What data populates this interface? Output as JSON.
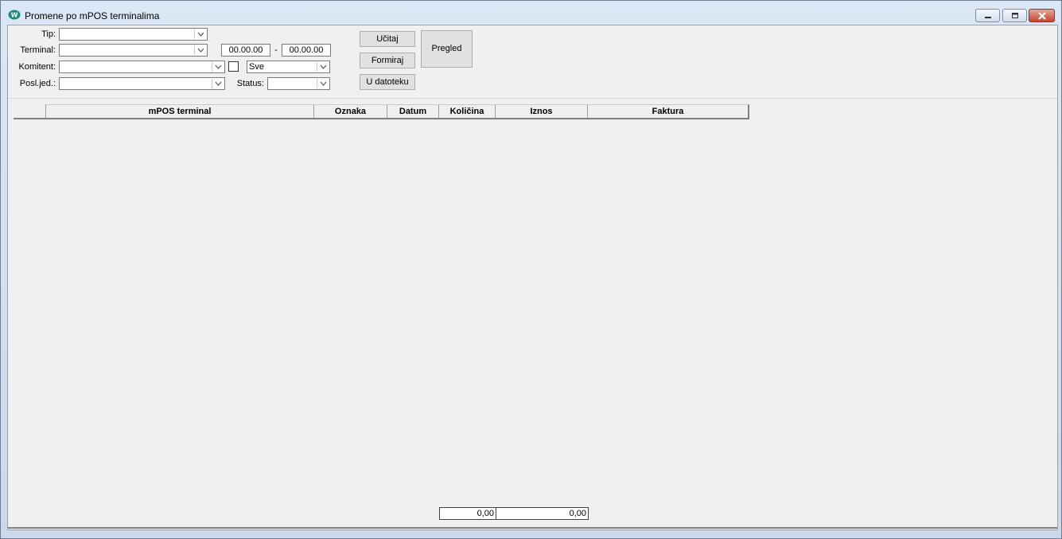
{
  "window": {
    "title": "Promene po mPOS terminalima",
    "icon": "app-logo-icon"
  },
  "filters": {
    "tip_label": "Tip:",
    "tip_value": "",
    "terminal_label": "Terminal:",
    "terminal_value": "",
    "date_from": "00.00.00",
    "date_separator": "-",
    "date_to": "00.00.00",
    "komitent_label": "Komitent:",
    "komitent_value": "",
    "sve_value": "Sve",
    "poslјed_label": "Posl.jed.:",
    "poslјed_value": "",
    "status_label": "Status:",
    "status_value": ""
  },
  "buttons": {
    "ucitaj": "Učitaj",
    "formiraj": "Formiraj",
    "u_datoteku": "U datoteku",
    "pregled": "Pregled"
  },
  "table": {
    "columns": [
      "",
      "mPOS terminal",
      "Oznaka",
      "Datum",
      "Količina",
      "Iznos",
      "Faktura"
    ],
    "rows": []
  },
  "totals": {
    "kolicina": "0,00",
    "iznos": "0,00"
  }
}
